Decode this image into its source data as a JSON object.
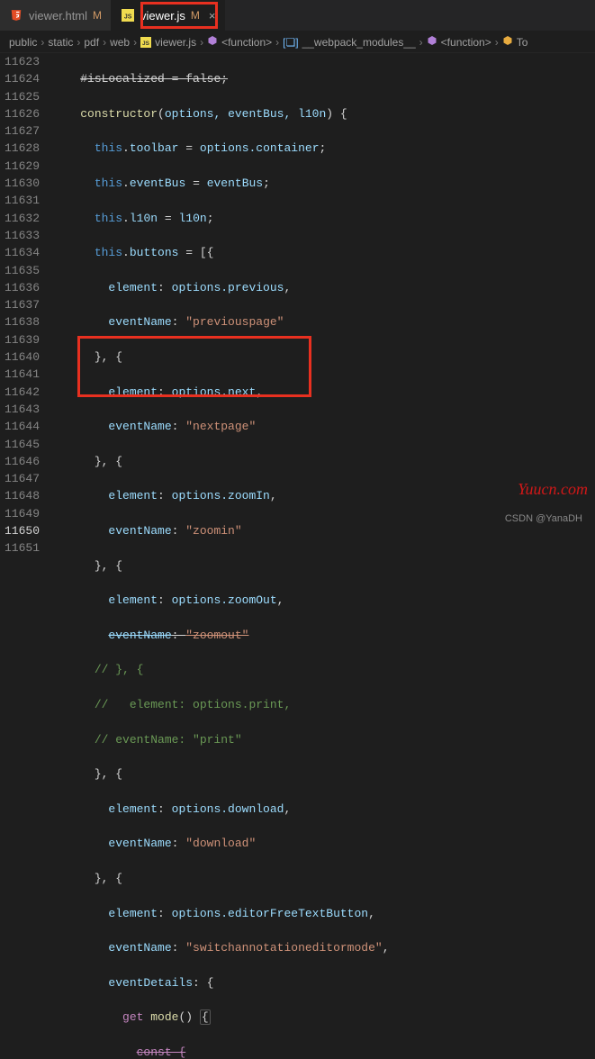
{
  "tabs": [
    {
      "icon": "html",
      "label": "viewer.html",
      "status": "M",
      "active": false
    },
    {
      "icon": "js",
      "label": "viewer.js",
      "status": "M",
      "active": true
    }
  ],
  "breadcrumbs": {
    "path": [
      "public",
      "static",
      "pdf",
      "web"
    ],
    "file": "viewer.js",
    "symbols": [
      "<function>",
      "__webpack_modules__",
      "<function>",
      "To"
    ]
  },
  "lines": {
    "start": 11623,
    "active": 11650,
    "visibleCount": 29
  },
  "code": {
    "l11624_constructor": "constructor",
    "l11624_params": "options, eventBus, l10n",
    "l11625_lhs": "toolbar",
    "l11625_rhs": "options.container",
    "l11626_lhs": "eventBus",
    "l11626_rhs": "eventBus",
    "l11627_lhs": "l10n",
    "l11627_rhs": "l10n",
    "l11628_lhs": "buttons",
    "l11629_key": "element",
    "l11629_val": "options.previous",
    "l11630_key": "eventName",
    "l11630_val": "\"previouspage\"",
    "l11632_key": "element",
    "l11632_val": "options.next",
    "l11633_key": "eventName",
    "l11633_val": "\"nextpage\"",
    "l11635_key": "element",
    "l11635_val": "options.zoomIn",
    "l11636_key": "eventName",
    "l11636_val": "\"zoomin\"",
    "l11638_key": "element",
    "l11638_val": "options.zoomOut",
    "l11639_key": "eventName",
    "l11639_val": "\"zoomout\"",
    "l11640_c": "// }, {",
    "l11641_c": "//   element: options.print,",
    "l11642_c": "// eventName: \"print\"",
    "l11644_key": "element",
    "l11644_val": "options.download",
    "l11645_key": "eventName",
    "l11645_val": "\"download\"",
    "l11647_key": "element",
    "l11647_val": "options.editorFreeTextButton",
    "l11648_key": "eventName",
    "l11648_val": "\"switchannotationeditormode\"",
    "l11649_key": "eventDetails",
    "l11650_get": "get",
    "l11650_mode": "mode"
  },
  "watermark": "Yuucn.com",
  "footer": "CSDN @YanaDH"
}
